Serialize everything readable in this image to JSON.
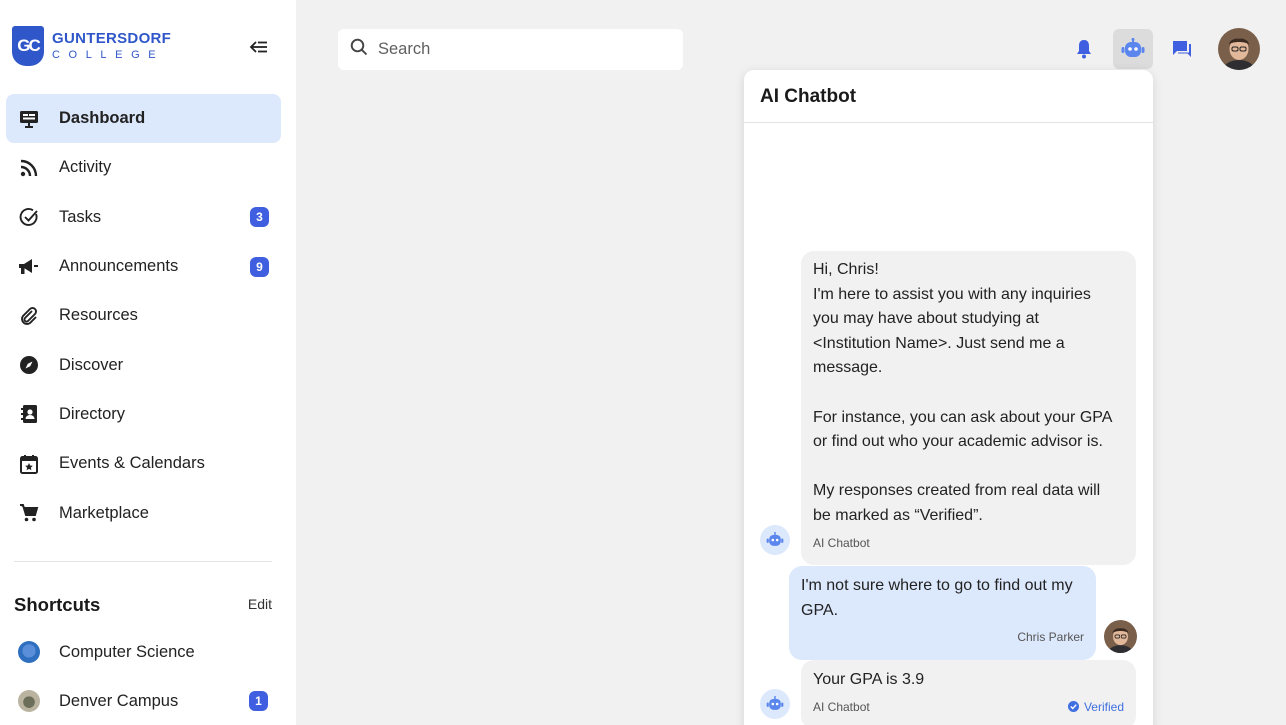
{
  "brand": {
    "mark": "GC",
    "name": "GUNTERSDORF",
    "subtitle": "COLLEGE"
  },
  "sidebar": {
    "items": [
      {
        "label": "Dashboard",
        "icon": "dashboard-monitor-icon",
        "active": true
      },
      {
        "label": "Activity",
        "icon": "rss-feed-icon"
      },
      {
        "label": "Tasks",
        "icon": "check-circle-icon",
        "badge": "3"
      },
      {
        "label": "Announcements",
        "icon": "megaphone-icon",
        "badge": "9"
      },
      {
        "label": "Resources",
        "icon": "paperclip-icon"
      },
      {
        "label": "Discover",
        "icon": "compass-icon"
      },
      {
        "label": "Directory",
        "icon": "contact-book-icon"
      },
      {
        "label": "Events & Calendars",
        "icon": "calendar-star-icon"
      },
      {
        "label": "Marketplace",
        "icon": "shopping-cart-icon"
      }
    ],
    "shortcuts_title": "Shortcuts",
    "edit_label": "Edit",
    "shortcuts": [
      {
        "label": "Computer Science"
      },
      {
        "label": "Denver Campus",
        "badge": "1"
      }
    ]
  },
  "search": {
    "placeholder": "Search"
  },
  "chat": {
    "title": "AI Chatbot",
    "messages": [
      {
        "from": "bot",
        "lines": [
          "Hi, Chris!",
          "I'm here to assist you with any inquiries",
          "you may have about studying at",
          "<Institution Name>. Just send me a",
          "message.",
          "",
          "For instance, you can ask about your GPA",
          "or find out who your academic advisor is.",
          "",
          "My responses created from real data will",
          "be marked as “Verified”."
        ],
        "sender": "AI Chatbot"
      },
      {
        "from": "user",
        "lines": [
          "I'm not sure where to go to find out my",
          "GPA."
        ],
        "sender": "Chris Parker"
      },
      {
        "from": "bot",
        "lines": [
          "Your GPA is 3.9"
        ],
        "sender": "AI Chatbot",
        "verified": "Verified"
      }
    ]
  },
  "colors": {
    "accent": "#3f5fe0",
    "brand": "#2f57c9",
    "active_bg": "#dce8fc"
  }
}
